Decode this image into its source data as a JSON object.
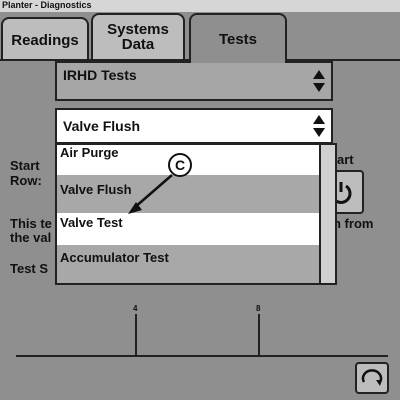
{
  "window": {
    "title": "Planter - Diagnostics"
  },
  "tabs": [
    {
      "label": "Readings"
    },
    {
      "label_line1": "Systems",
      "label_line2": "Data"
    },
    {
      "label": "Tests"
    }
  ],
  "test_select": {
    "value": "IRHD Tests"
  },
  "test_type_select": {
    "value": "Valve Flush"
  },
  "dropdown": {
    "options": [
      "Air Purge",
      "Valve Flush",
      "Valve Test",
      "Accumulator Test"
    ]
  },
  "background_text": {
    "start": "Start",
    "row": "Row:",
    "start_right": "art",
    "this_te": "This te",
    "from": "n from",
    "the_val": "the val",
    "test_s": "Test S"
  },
  "chart": {
    "tick_labels": [
      "4",
      "8"
    ]
  },
  "callout": {
    "label": "C"
  },
  "icons": {
    "power": "power-icon",
    "refresh": "refresh-icon",
    "callout_arrow": "arrow-icon"
  }
}
